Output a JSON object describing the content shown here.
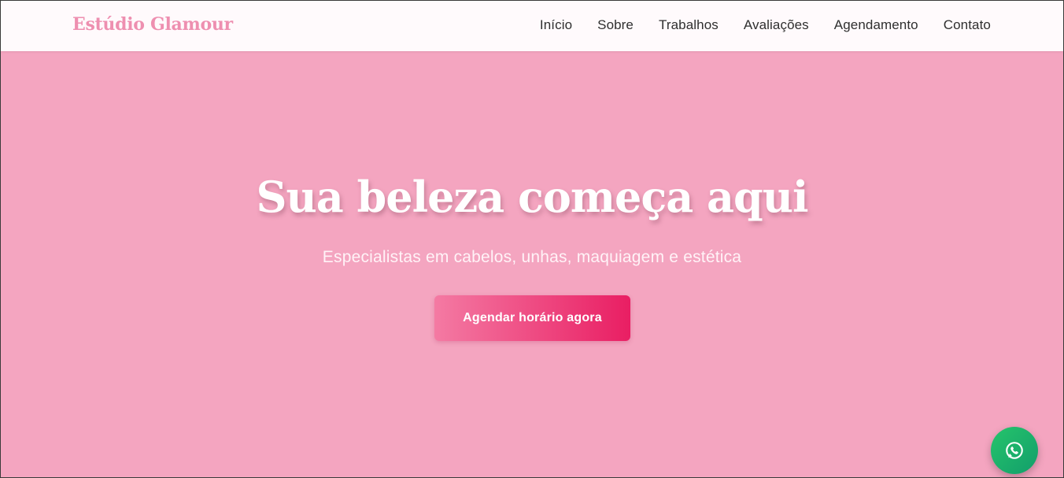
{
  "header": {
    "brand": "Estúdio Glamour",
    "nav": [
      {
        "label": "Início"
      },
      {
        "label": "Sobre"
      },
      {
        "label": "Trabalhos"
      },
      {
        "label": "Avaliações"
      },
      {
        "label": "Agendamento"
      },
      {
        "label": "Contato"
      }
    ]
  },
  "hero": {
    "title": "Sua beleza começa aqui",
    "subtitle": "Especialistas em cabelos, unhas, maquiagem e estética",
    "cta_label": "Agendar horário agora"
  },
  "floating": {
    "icon": "whatsapp-icon"
  },
  "colors": {
    "hero_background": "#f4a5c0",
    "brand": "#ee8fb0",
    "cta_start": "#f47aa3",
    "cta_end": "#e91e63",
    "whatsapp": "#25c16a"
  }
}
